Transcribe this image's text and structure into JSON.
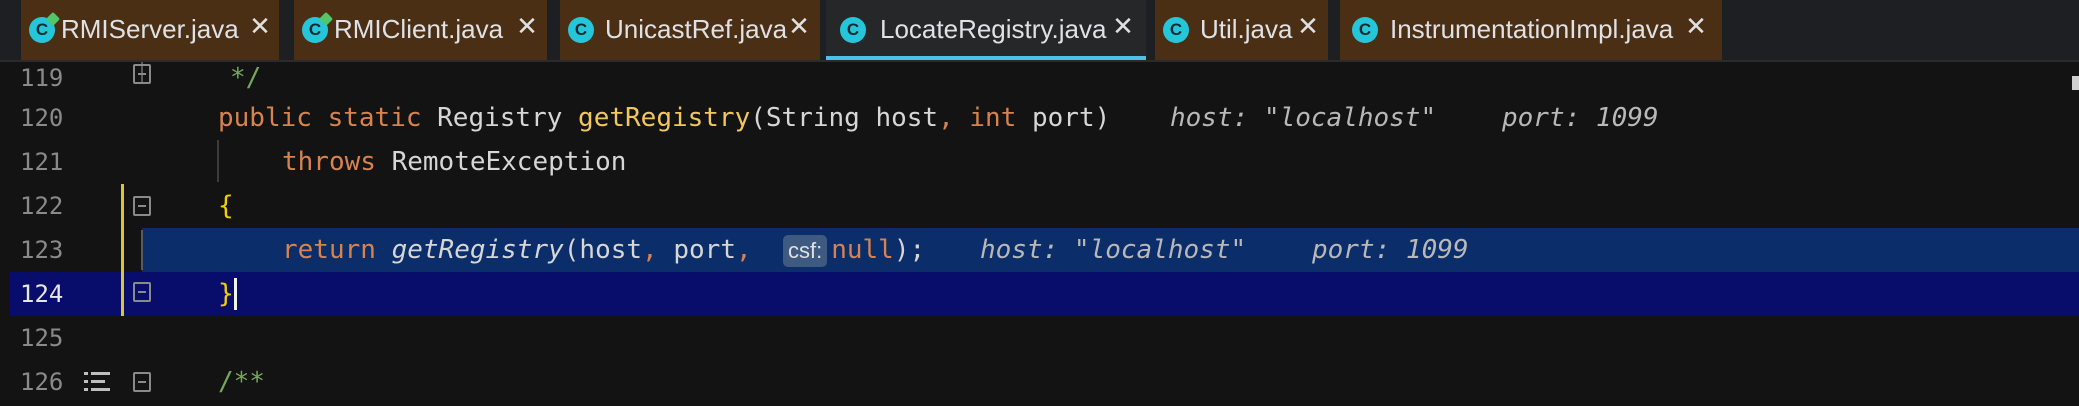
{
  "tabs": [
    {
      "label": "RMIServer.java",
      "icon": "java-run-icon",
      "active": false
    },
    {
      "label": "RMIClient.java",
      "icon": "java-run-icon",
      "active": false
    },
    {
      "label": "UnicastRef.java",
      "icon": "java-class-icon",
      "active": false
    },
    {
      "label": "LocateRegistry.java",
      "icon": "java-class-icon",
      "active": true
    },
    {
      "label": "Util.java",
      "icon": "java-class-icon",
      "active": false
    },
    {
      "label": "InstrumentationImpl.java",
      "icon": "java-class-icon",
      "active": false
    }
  ],
  "tab_icon_letter": "C",
  "close_glyph": "✕",
  "lines": {
    "l119": {
      "num": "119",
      "text": "*/"
    },
    "l120": {
      "num": "120",
      "kw1": "public",
      "kw2": "static",
      "type": "Registry",
      "fn": "getRegistry",
      "args1": "(String host",
      "comma": ",",
      "kw3": "int",
      "args2": "port)",
      "hint_host": "host: \"localhost\"",
      "hint_port": "port: 1099"
    },
    "l121": {
      "num": "121",
      "kw": "throws",
      "type": "RemoteException"
    },
    "l122": {
      "num": "122",
      "brace": "{"
    },
    "l123": {
      "num": "123",
      "kw": "return",
      "fn": "getRegistry",
      "args": "(host",
      "c1": ",",
      "port": "port",
      "c2": ",",
      "badge": "csf:",
      "null": "null",
      "end": ");",
      "hint_host": "host: \"localhost\"",
      "hint_port": "port: 1099"
    },
    "l124": {
      "num": "124",
      "brace": "}"
    },
    "l125": {
      "num": "125"
    },
    "l126": {
      "num": "126",
      "comment": "/**"
    }
  },
  "colors": {
    "keyword": "#d6834d",
    "function": "#f0c75e",
    "selection": "#0b2d6a",
    "current_line": "#080c6b",
    "tab_accent": "#4fc1e9"
  }
}
